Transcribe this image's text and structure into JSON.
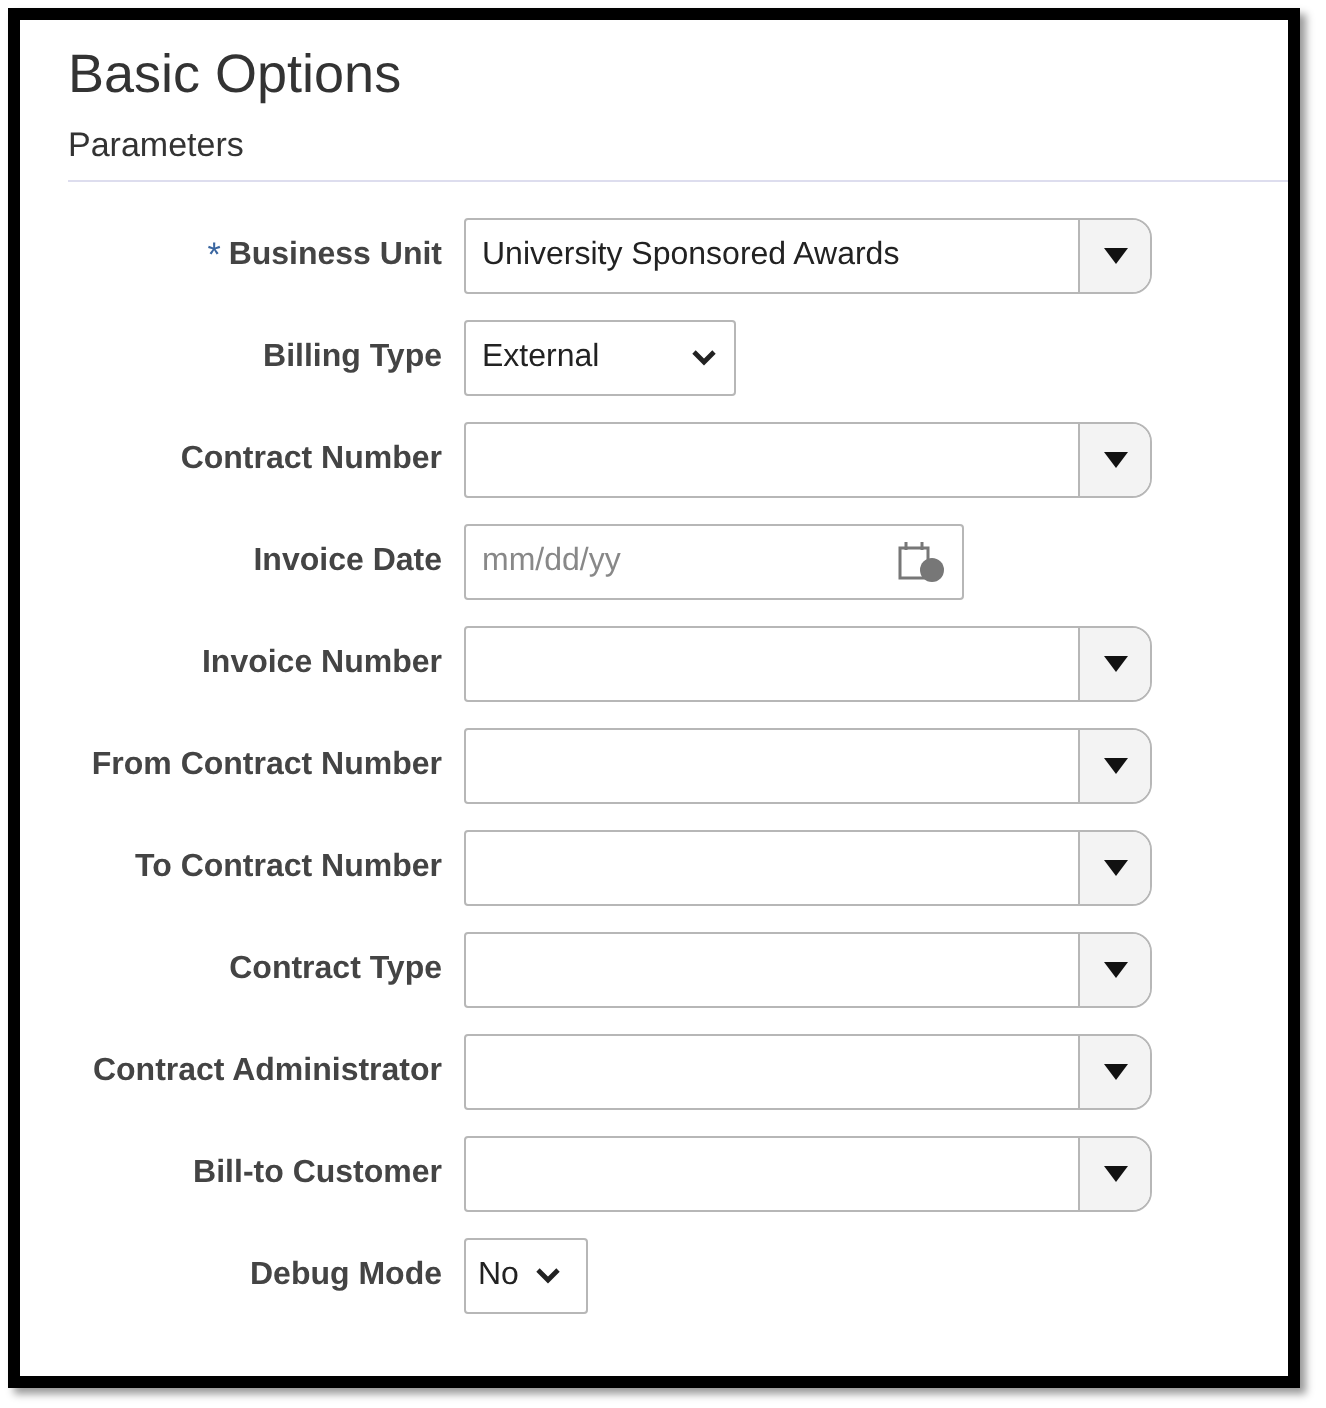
{
  "title": "Basic Options",
  "section": "Parameters",
  "fields": [
    {
      "label": "Business Unit",
      "required_mark": "*",
      "kind": "combo",
      "value": "University Sponsored Awards"
    },
    {
      "label": "Billing Type",
      "kind": "select",
      "value": "External"
    },
    {
      "label": "Contract Number",
      "kind": "combo"
    },
    {
      "label": "Invoice Date",
      "kind": "date",
      "placeholder": "mm/dd/yy"
    },
    {
      "label": "Invoice Number",
      "kind": "combo"
    },
    {
      "label": "From Contract Number",
      "kind": "combo"
    },
    {
      "label": "To Contract Number",
      "kind": "combo"
    },
    {
      "label": "Contract Type",
      "kind": "combo"
    },
    {
      "label": "Contract Administrator",
      "kind": "combo"
    },
    {
      "label": "Bill-to Customer",
      "kind": "combo"
    },
    {
      "label": "Debug Mode",
      "kind": "smallselect",
      "value": "No"
    }
  ]
}
